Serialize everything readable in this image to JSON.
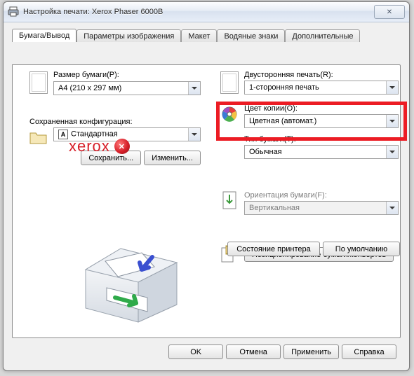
{
  "window": {
    "title": "Настройка печати: Xerox Phaser 6000B",
    "close_glyph": "✕"
  },
  "tabs": {
    "t0": "Бумага/Вывод",
    "t1": "Параметры изображения",
    "t2": "Макет",
    "t3": "Водяные знаки",
    "t4": "Дополнительные"
  },
  "paper_size": {
    "label": "Размер бумаги(P):",
    "value": "A4 (210 x 297 мм)"
  },
  "saved_cfg": {
    "label": "Сохраненная конфигурация:",
    "value": "Стандартная",
    "save": "Сохранить...",
    "edit": "Изменить..."
  },
  "duplex": {
    "label": "Двусторонняя печать(R):",
    "value": "1-сторонняя печать"
  },
  "color": {
    "label": "Цвет копии(O):",
    "value": "Цветная (автомат.)"
  },
  "paper_type": {
    "label": "Тип бумаги(T):",
    "value": "Обычная"
  },
  "orientation": {
    "label": "Ориентация бумаги(F):",
    "value": "Вертикальная"
  },
  "positioning_btn": "Позиционирование бумаги/конвертов",
  "printer_state_btn": "Состояние принтера",
  "defaults_btn": "По умолчанию",
  "brand": "xerox",
  "footer": {
    "ok": "OK",
    "cancel": "Отмена",
    "apply": "Применить",
    "help": "Справка"
  }
}
